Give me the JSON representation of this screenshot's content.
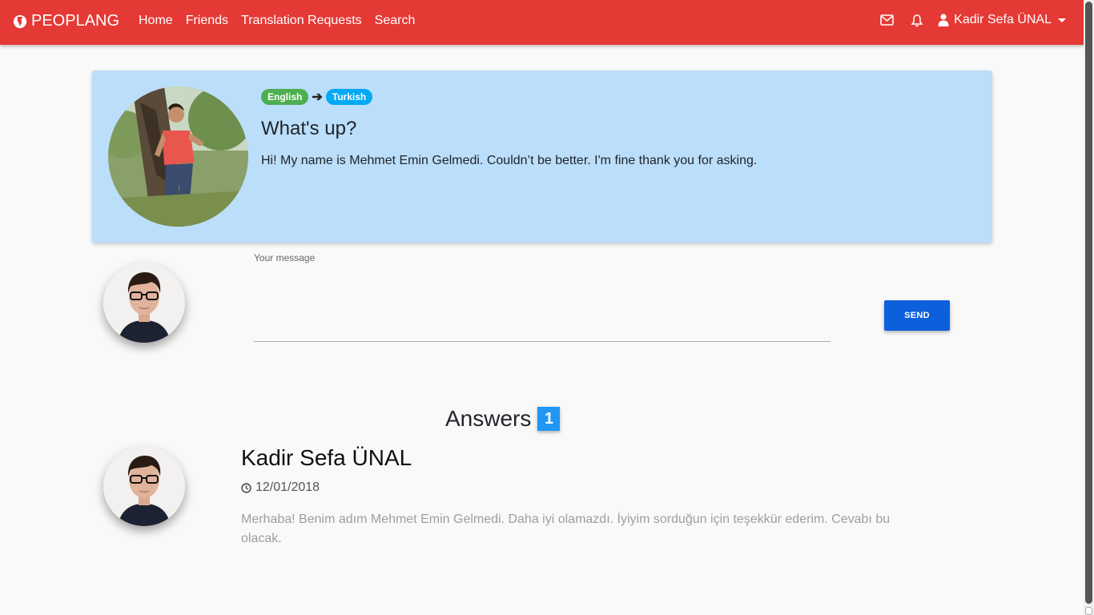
{
  "navbar": {
    "brand": "PEOPLANG",
    "links": [
      "Home",
      "Friends",
      "Translation Requests",
      "Search"
    ],
    "user_name": "Kadir Sefa ÜNAL",
    "color": "#e53935"
  },
  "post": {
    "source_language": "English",
    "target_language": "Turkish",
    "title": "What's up?",
    "body": "Hi! My name is Mehmet Emin Gelmedi. Couldn’t be better. I'm fine thank you for asking.",
    "card_color": "#bbdefb"
  },
  "composer": {
    "label": "Your message",
    "value": "",
    "send_label": "SEND"
  },
  "answers": {
    "title": "Answers",
    "count": "1",
    "items": [
      {
        "author": "Kadir Sefa ÜNAL",
        "date": "12/01/2018",
        "text": "Merhaba! Benim adım Mehmet Emin Gelmedi. Daha iyi olamazdı. İyiyim sorduğun için teşekkür ederim. Cevabı bu olacak."
      }
    ]
  }
}
